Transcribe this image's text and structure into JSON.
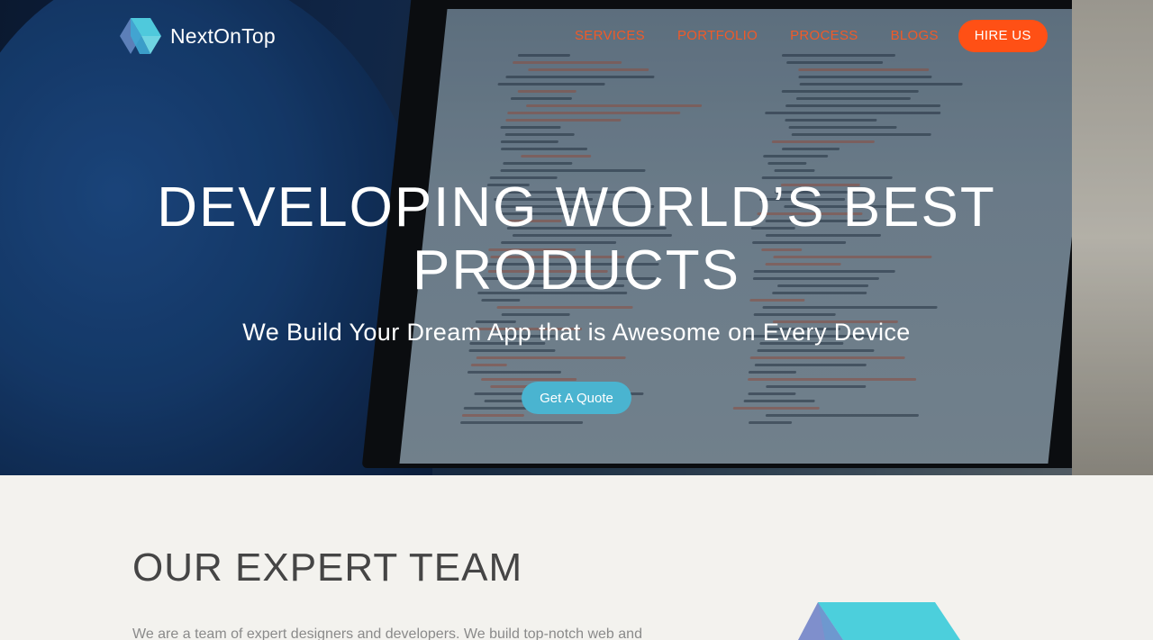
{
  "brand": {
    "name": "NextOnTop",
    "logo_icon": "nextontop-logo-icon"
  },
  "nav": {
    "links": [
      {
        "label": "SERVICES"
      },
      {
        "label": "PORTFOLIO"
      },
      {
        "label": "PROCESS"
      },
      {
        "label": "BLOGS"
      }
    ],
    "cta_label": "HIRE US"
  },
  "hero": {
    "title": "DEVELOPING WORLD’S BEST PRODUCTS",
    "subtitle": "We Build Your Dream App that is Awesome on Every Device",
    "button_label": "Get A Quote"
  },
  "team": {
    "title": "OUR EXPERT TEAM",
    "text": "We are a team of expert designers and developers. We build top-notch web and"
  },
  "colors": {
    "nav_link": "#f05a28",
    "cta": "#ff5015",
    "quote_button": "#4ab4d0",
    "section_bg": "#f3f2ee"
  }
}
